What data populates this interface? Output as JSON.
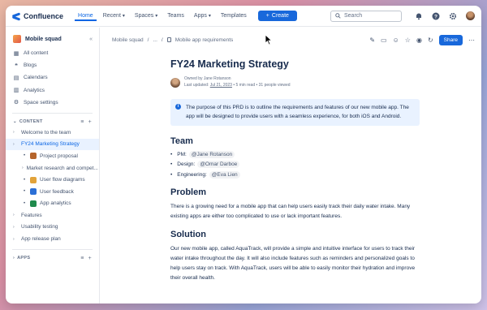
{
  "topnav": {
    "product": "Confluence",
    "items": [
      {
        "label": "Home",
        "caret": false,
        "active": true
      },
      {
        "label": "Recent",
        "caret": true,
        "active": false
      },
      {
        "label": "Spaces",
        "caret": true,
        "active": false
      },
      {
        "label": "Teams",
        "caret": false,
        "active": false
      },
      {
        "label": "Apps",
        "caret": true,
        "active": false
      },
      {
        "label": "Templates",
        "caret": false,
        "active": false
      }
    ],
    "create_label": "Create",
    "search_placeholder": "Search"
  },
  "sidebar": {
    "space_name": "Mobile squad",
    "links": [
      {
        "label": "All content",
        "icon": "grid-icon"
      },
      {
        "label": "Blogs",
        "icon": "quote-icon"
      },
      {
        "label": "Calendars",
        "icon": "calendar-icon"
      },
      {
        "label": "Analytics",
        "icon": "chart-icon"
      },
      {
        "label": "Space settings",
        "icon": "gear-icon"
      }
    ],
    "content_header": "CONTENT",
    "tree": [
      {
        "label": "Welcome to the team",
        "type": "chevron",
        "indent": false,
        "selected": false
      },
      {
        "label": "FY24 Marketing Strategy",
        "type": "chevron",
        "indent": false,
        "selected": true
      },
      {
        "label": "Project proposal",
        "type": "emoji",
        "indent": true,
        "selected": false
      },
      {
        "label": "Market research and compet...",
        "type": "chevron",
        "indent": true,
        "selected": false
      },
      {
        "label": "User flow diagrams",
        "type": "emoji",
        "indent": true,
        "selected": false
      },
      {
        "label": "User feedback",
        "type": "emoji",
        "indent": true,
        "selected": false
      },
      {
        "label": "App analytics",
        "type": "emoji",
        "indent": true,
        "selected": false
      },
      {
        "label": "Features",
        "type": "chevron",
        "indent": false,
        "selected": false
      },
      {
        "label": "Usability testing",
        "type": "chevron",
        "indent": false,
        "selected": false
      },
      {
        "label": "App release plan",
        "type": "chevron",
        "indent": false,
        "selected": false
      }
    ],
    "apps_header": "APPS"
  },
  "breadcrumb": {
    "space": "Mobile squad",
    "ellipsis": "...",
    "page": "Mobile app requirements",
    "share_label": "Share"
  },
  "page": {
    "title": "FY24 Marketing Strategy",
    "owner": "Owned by Jane Rotanson",
    "updated": "Last updated:",
    "date": "Jul 21, 2023",
    "read_time": "5 min read",
    "viewed": "31 people viewed",
    "info": "The purpose of this PRD is to outline the requirements and features of our new mobile app. The app will be designed to provide users with a seamless experience, for both iOS and Android.",
    "team_heading": "Team",
    "team": [
      {
        "role": "PM:",
        "name": "@Jane Rotanson"
      },
      {
        "role": "Design:",
        "name": "@Omar Darboe"
      },
      {
        "role": "Engineering:",
        "name": "@Eva Lien"
      }
    ],
    "problem_heading": "Problem",
    "problem_text": "There is a growing need for a mobile app that can help users easily track their daily water intake. Many existing apps are either too complicated to use or lack important features.",
    "solution_heading": "Solution",
    "solution_text": "Our new mobile app, called AquaTrack, will provide a simple and intuitive interface for users to track their water intake throughout the day. It will also include features such as reminders and personalized goals to help users stay on track. With AquaTrack, users will be able to easily monitor their hydration and improve their overall health."
  },
  "colors": {
    "brand_blue": "#1868db",
    "selected_bg": "#e9f2ff",
    "text": "#172b4d"
  }
}
